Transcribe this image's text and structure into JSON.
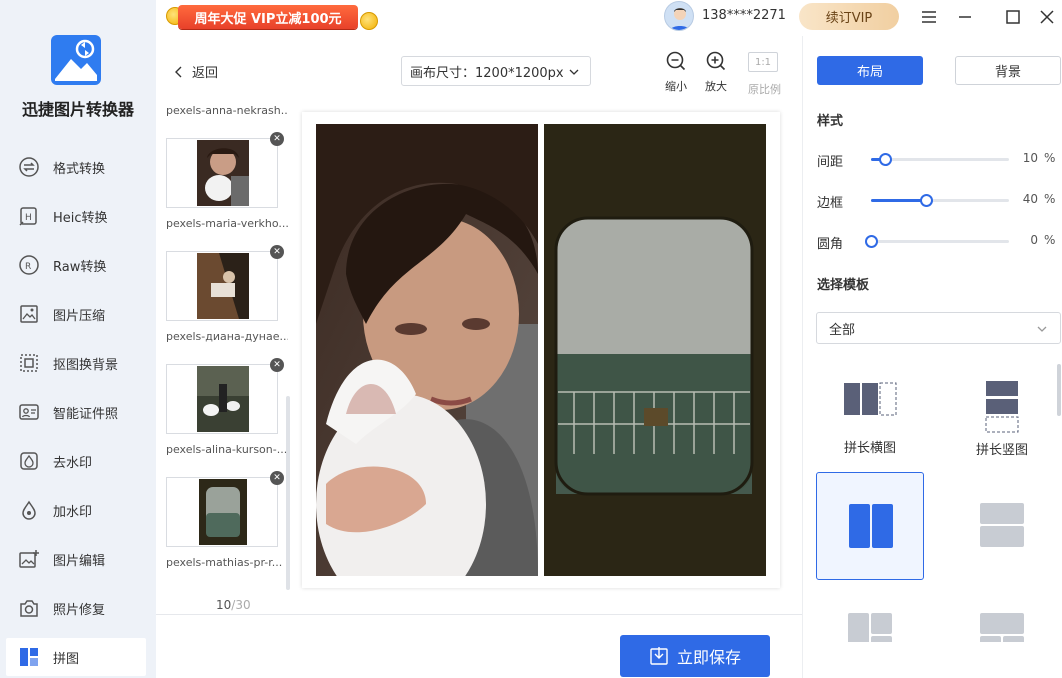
{
  "app": {
    "title": "迅捷图片转换器"
  },
  "sidebar": {
    "items": [
      {
        "label": "格式转换",
        "icon": "format-convert-icon"
      },
      {
        "label": "Heic转换",
        "icon": "heic-icon"
      },
      {
        "label": "Raw转换",
        "icon": "raw-icon"
      },
      {
        "label": "图片压缩",
        "icon": "compress-icon"
      },
      {
        "label": "抠图换背景",
        "icon": "cutout-icon"
      },
      {
        "label": "智能证件照",
        "icon": "id-photo-icon"
      },
      {
        "label": "去水印",
        "icon": "remove-watermark-icon"
      },
      {
        "label": "加水印",
        "icon": "add-watermark-icon"
      },
      {
        "label": "图片编辑",
        "icon": "image-edit-icon"
      },
      {
        "label": "照片修复",
        "icon": "photo-repair-icon"
      },
      {
        "label": "拼图",
        "icon": "collage-icon",
        "active": true
      }
    ]
  },
  "topbar": {
    "promo": "周年大促 VIP立减100元",
    "phone": "138****2271",
    "vip_button": "续订VIP"
  },
  "workspace": {
    "back_label": "返回",
    "canvas_size_label": "画布尺寸：1200*1200px",
    "zoom_out_label": "缩小",
    "zoom_in_label": "放大",
    "ratio_box": "1:1",
    "ratio_label": "原比例",
    "first_caption": "pexels-anna-nekrash...",
    "thumbnails": [
      {
        "caption": "pexels-maria-verkho..."
      },
      {
        "caption": "pexels-диана-дунае..."
      },
      {
        "caption": "pexels-alina-kurson-..."
      },
      {
        "caption": "pexels-mathias-pr-r..."
      }
    ],
    "counter_current": "10",
    "counter_total": "/30",
    "save_button": "立即保存"
  },
  "panel": {
    "tab_layout": "布局",
    "tab_background": "背景",
    "style_title": "样式",
    "sliders": [
      {
        "label": "间距",
        "value": "10",
        "unit": "%",
        "fraction": 0.1
      },
      {
        "label": "边框",
        "value": "40",
        "unit": "%",
        "fraction": 0.4
      },
      {
        "label": "圆角",
        "value": "0",
        "unit": "%",
        "fraction": 0.0
      }
    ],
    "template_title": "选择模板",
    "template_select": "全部",
    "templates": [
      {
        "label": "拼长横图"
      },
      {
        "label": "拼长竖图"
      }
    ]
  },
  "colors": {
    "accent": "#2f6ae6",
    "sidebar_bg": "#eef2f8",
    "promo_red": "#e8412a"
  }
}
